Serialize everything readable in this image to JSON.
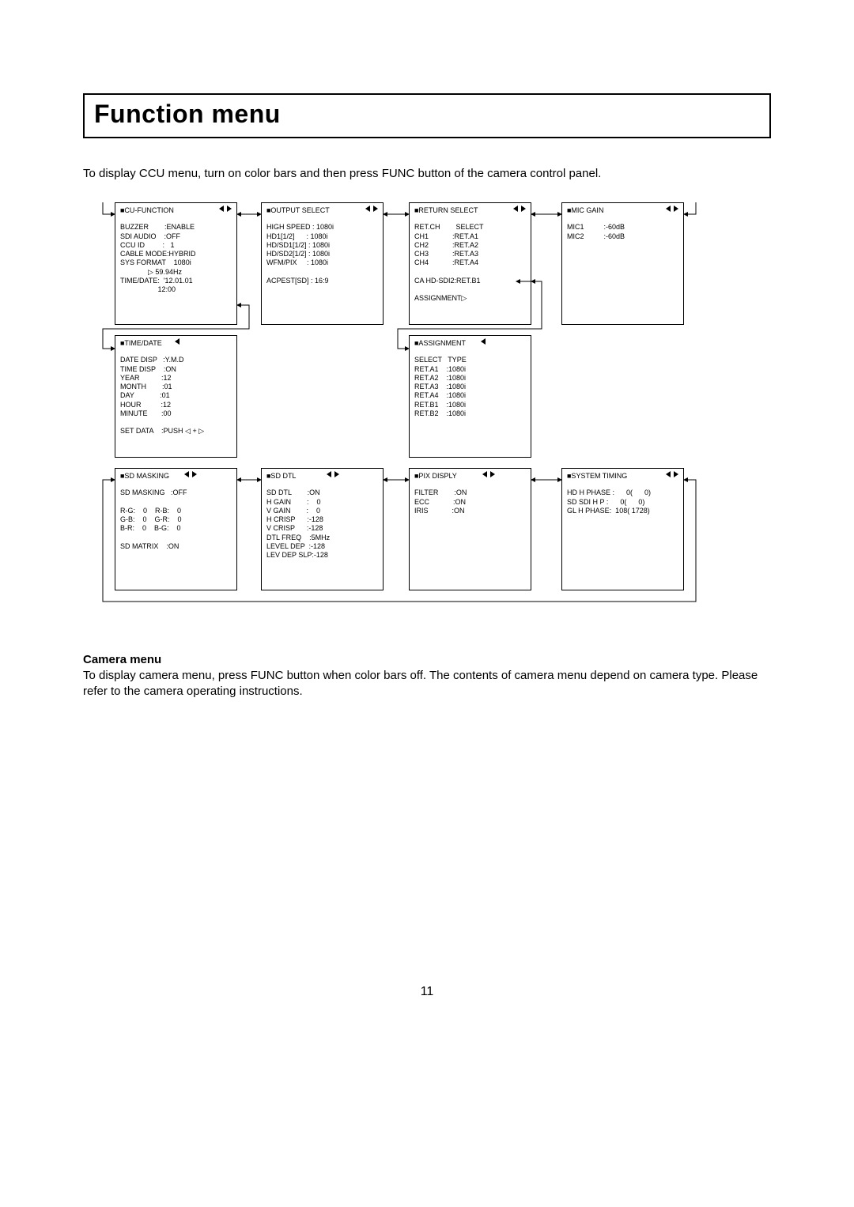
{
  "title": "Function menu",
  "intro": "To display CCU menu, turn on color bars and then press FUNC button of the camera control panel.",
  "boxes": {
    "cuFunction": {
      "header": "■CU-FUNCTION",
      "body": "BUZZER        :ENABLE\nSDI AUDIO    :OFF\nCCU ID         :   1\nCABLE MODE:HYBRID\nSYS FORMAT    1080i\n              ▷ 59.94Hz\nTIME/DATE:  '12.01.01\n                   12:00"
    },
    "outputSelect": {
      "header": "■OUTPUT SELECT",
      "body": "HIGH SPEED : 1080i\nHD1[1/2]      : 1080i\nHD/SD1[1/2] : 1080i\nHD/SD2[1/2] : 1080i\nWFM/PIX     : 1080i\n\nACPEST[SD] : 16:9"
    },
    "returnSelect": {
      "header": "■RETURN SELECT",
      "body": "RET.CH        SELECT\nCH1            :RET.A1\nCH2            :RET.A2\nCH3            :RET.A3\nCH4            :RET.A4\n\nCA HD-SDI2:RET.B1\n\nASSIGNMENT▷"
    },
    "micGain": {
      "header": "■MIC GAIN",
      "body": "MIC1          :-60dB\nMIC2          :-60dB"
    },
    "timeDate": {
      "header": "■TIME/DATE",
      "body": "DATE DISP   :Y.M.D\nTIME DISP    :ON\nYEAR           :12\nMONTH        :01\nDAY             :01\nHOUR          :12\nMINUTE       :00\n\nSET DATA    :PUSH ◁ + ▷"
    },
    "assignment": {
      "header": "■ASSIGNMENT",
      "body": "SELECT   TYPE\nRET.A1    :1080i\nRET.A2    :1080i\nRET.A3    :1080i\nRET.A4    :1080i\nRET.B1    :1080i\nRET.B2    :1080i"
    },
    "sdMasking": {
      "header": "■SD MASKING",
      "body": "SD MASKING   :OFF\n\nR-G:    0    R-B:    0\nG-B:    0    G-R:    0\nB-R:    0    B-G:    0\n\nSD MATRIX    :ON"
    },
    "sdDtl": {
      "header": "■SD DTL",
      "body": "SD DTL        :ON\nH GAIN        :    0\nV GAIN        :    0\nH CRISP      :-128\nV CRISP      :-128\nDTL FREQ    :5MHz\nLEVEL DEP  :-128\nLEV DEP SLP:-128"
    },
    "pixDisply": {
      "header": "■PIX DISPLY",
      "body": "FILTER        :ON\nECC            :ON\nIRIS            :ON"
    },
    "systemTiming": {
      "header": "■SYSTEM TIMING",
      "body": "HD H PHASE :      0(      0)\nSD SDI H P :      0(      0)\nGL H PHASE:  108( 1728)"
    }
  },
  "cameraMenu": {
    "heading": "Camera menu",
    "body": "To display camera menu, press FUNC button when color bars off. The contents of camera menu depend on camera type. Please refer to the camera operating instructions."
  },
  "pageNumber": "11"
}
